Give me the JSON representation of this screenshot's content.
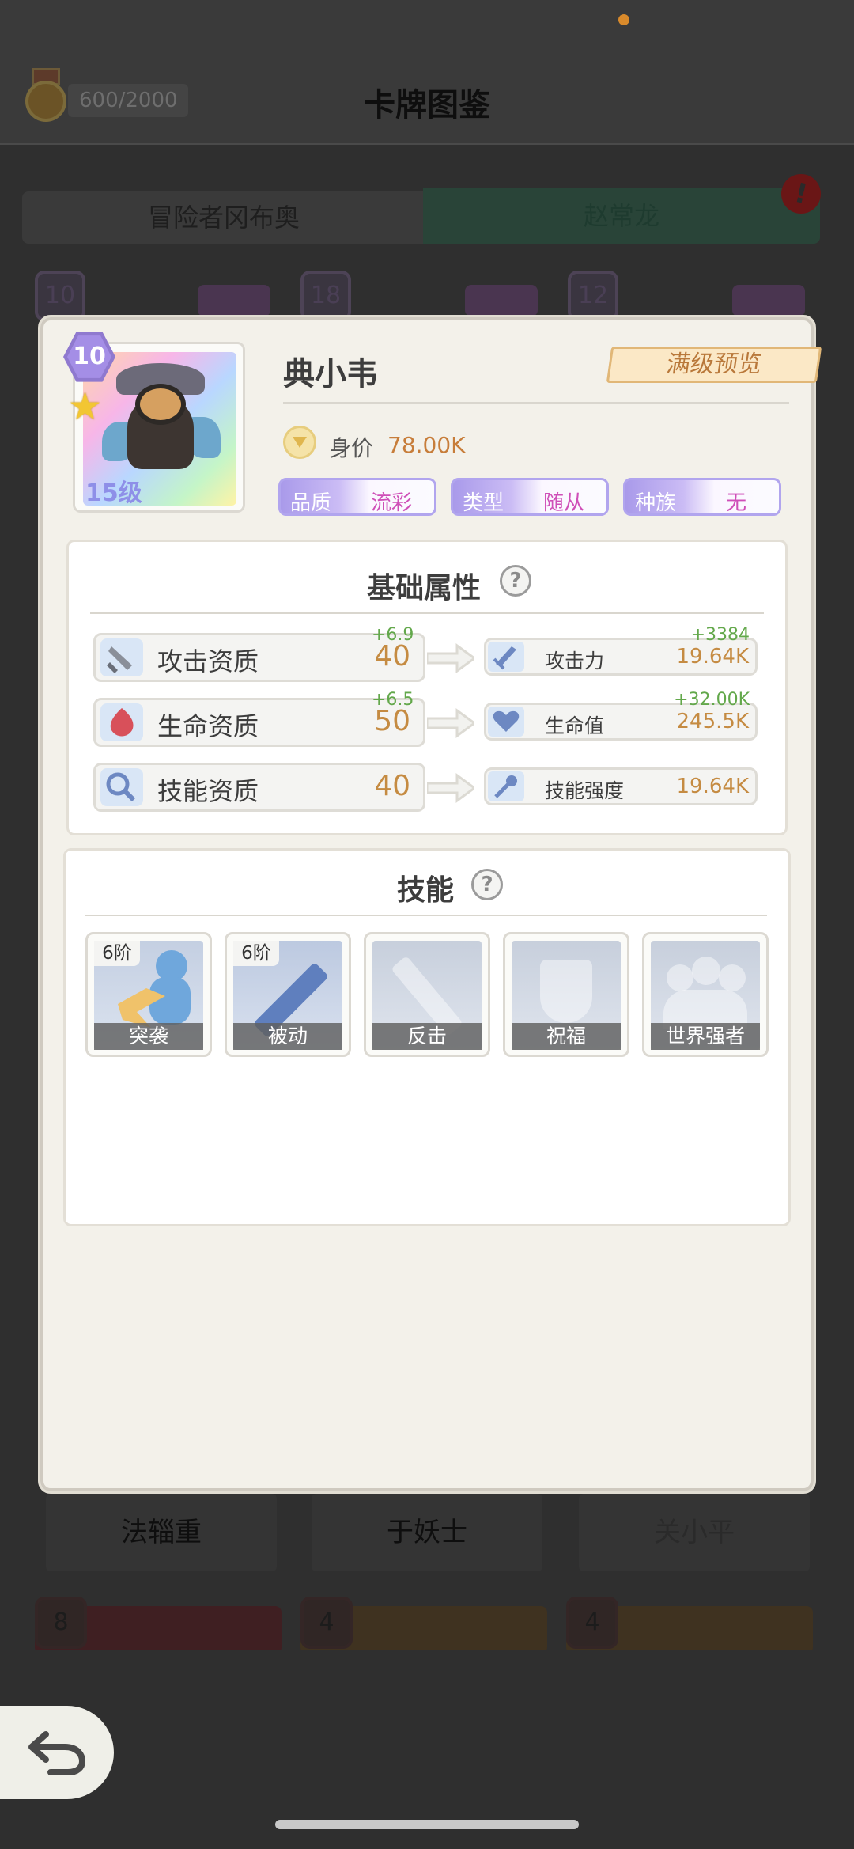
{
  "header": {
    "title": "卡牌图鉴",
    "exp_progress": "600/2000"
  },
  "tabs": [
    {
      "label": "冒险者冈布奥"
    },
    {
      "label": "赵常龙"
    }
  ],
  "alert_badge": "!",
  "background_cards": {
    "top_row_levels": [
      "10",
      "18",
      "12"
    ],
    "names": [
      "法辎重",
      "于妖士",
      "关小平"
    ],
    "bottom_row_levels": [
      "8",
      "4",
      "4"
    ]
  },
  "hero": {
    "name": "典小韦",
    "star_level": "10",
    "level_label": "15级",
    "value_label": "身价",
    "value": "78.00K",
    "full_level_preview_label": "满级预览",
    "tags": [
      {
        "key": "品质",
        "value": "流彩"
      },
      {
        "key": "类型",
        "value": "随从"
      },
      {
        "key": "种族",
        "value": "无"
      }
    ]
  },
  "base_attributes": {
    "title": "基础属性",
    "help": "?",
    "rows": [
      {
        "label": "攻击资质",
        "bonus": "+6.9",
        "value": "40",
        "stat_label": "攻击力",
        "stat_bonus": "+3384",
        "stat_value": "19.64K",
        "icon": "sword-icon",
        "stat_icon": "sword-icon"
      },
      {
        "label": "生命资质",
        "bonus": "+6.5",
        "value": "50",
        "stat_label": "生命值",
        "stat_bonus": "+32.00K",
        "stat_value": "245.5K",
        "icon": "blood-drop-icon",
        "stat_icon": "heart-icon"
      },
      {
        "label": "技能资质",
        "bonus": "",
        "value": "40",
        "stat_label": "技能强度",
        "stat_bonus": "",
        "stat_value": "19.64K",
        "icon": "magnifier-icon",
        "stat_icon": "wand-icon"
      }
    ]
  },
  "skills": {
    "title": "技能",
    "help": "?",
    "items": [
      {
        "name": "突袭",
        "tier": "6阶",
        "icon": "assault-icon"
      },
      {
        "name": "被动",
        "tier": "6阶",
        "icon": "sword-icon"
      },
      {
        "name": "反击",
        "tier": "",
        "icon": "counter-sword-icon"
      },
      {
        "name": "祝福",
        "tier": "",
        "icon": "shield-icon"
      },
      {
        "name": "世界强者",
        "tier": "",
        "icon": "heroes-icon"
      }
    ]
  },
  "colors": {
    "accent_gold": "#c58b42",
    "bonus_green": "#63a84b",
    "tag_purple": "#a99aea",
    "preview_orange": "#b9783a"
  }
}
